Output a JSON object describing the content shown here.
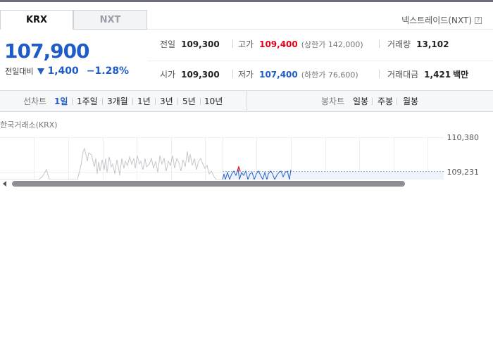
{
  "tabs": [
    {
      "label": "KRX",
      "active": true
    },
    {
      "label": "NXT",
      "active": false
    }
  ],
  "nxt_link": {
    "label": "넥스트레이드(NXT)",
    "help": "?"
  },
  "price": {
    "current": "107,900",
    "change_label": "전일대비",
    "change_amount": "1,400",
    "change_pct": "−1.28%",
    "direction": "down",
    "color": "#1f5cc8"
  },
  "quote": {
    "prev_close": {
      "label": "전일",
      "value": "109,300"
    },
    "high": {
      "label": "고가",
      "value": "109,400",
      "sub": "(상한가 142,000)"
    },
    "volume": {
      "label": "거래량",
      "value": "13,102"
    },
    "open": {
      "label": "시가",
      "value": "109,300"
    },
    "low": {
      "label": "저가",
      "value": "107,400",
      "sub": "(하한가 76,600)"
    },
    "turnover": {
      "label": "거래대금",
      "value": "1,421",
      "unit": "백만"
    }
  },
  "colors": {
    "up": "#e4001b",
    "down": "#1f5cc8"
  },
  "nav": {
    "line_chart_label": "선차트",
    "periods": [
      {
        "label": "1일",
        "active": true
      },
      {
        "label": "1주일",
        "active": false
      },
      {
        "label": "3개월",
        "active": false
      },
      {
        "label": "1년",
        "active": false
      },
      {
        "label": "3년",
        "active": false
      },
      {
        "label": "5년",
        "active": false
      },
      {
        "label": "10년",
        "active": false
      }
    ],
    "candle_chart_label": "봉차트",
    "candle_periods": [
      {
        "label": "일봉"
      },
      {
        "label": "주봉"
      },
      {
        "label": "월봉"
      }
    ]
  },
  "chart": {
    "title": "한국거래소(KRX)",
    "y_labels": [
      "110,380",
      "109,231"
    ]
  }
}
